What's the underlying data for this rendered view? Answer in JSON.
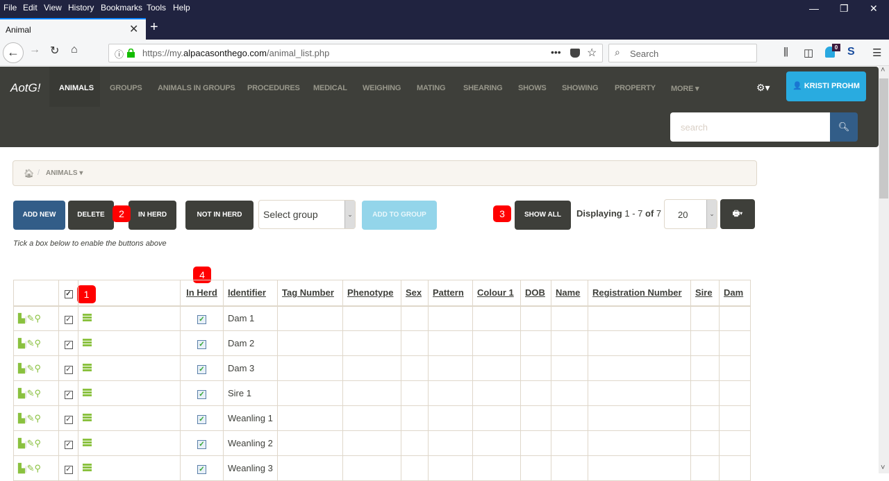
{
  "browser": {
    "menu": [
      "File",
      "Edit",
      "View",
      "History",
      "Bookmarks",
      "Tools",
      "Help"
    ],
    "tab_title": "Animal",
    "url_prefix": "https://my.",
    "url_domain": "alpacasonthego.com",
    "url_path": "/animal_list.php",
    "search_placeholder": "Search",
    "ghostery_count": "0",
    "window_controls": {
      "minimize": "—",
      "restore": "❐",
      "close": "✕"
    }
  },
  "app": {
    "brand": "AotG!",
    "nav": [
      "ANIMALS",
      "GROUPS",
      "ANIMALS IN GROUPS",
      "PROCEDURES",
      "MEDICAL",
      "WEIGHING",
      "MATING",
      "SHEARING",
      "SHOWS",
      "SHOWING",
      "PROPERTY",
      "MORE ▾"
    ],
    "active_nav": "ANIMALS",
    "user": "KRISTI PROHM",
    "search_placeholder": "search",
    "colors": {
      "navbar": "#3e3f3a",
      "primary": "#325d88",
      "info": "#29abe0",
      "badge": "#ff0000",
      "icon_green": "#8ac13f"
    }
  },
  "breadcrumb": {
    "current": "ANIMALS ▾"
  },
  "toolbar": {
    "add_new": "ADD NEW",
    "delete": "DELETE",
    "in_herd": "IN HERD",
    "not_in_herd": "NOT IN HERD",
    "select_group": "Select group",
    "add_to_group": "ADD TO GROUP",
    "show_all": "SHOW ALL",
    "displaying_label": "Displaying",
    "displaying_range": "1 - 7",
    "of_label": "of",
    "total": "7",
    "per_page": "20",
    "hint": "Tick a box below to enable the buttons above"
  },
  "badges": {
    "b1": "1",
    "b2": "2",
    "b3": "3",
    "b4": "4"
  },
  "table": {
    "columns": [
      "In Herd",
      "Identifier",
      "Tag Number",
      "Phenotype",
      "Sex",
      "Pattern",
      "Colour 1",
      "DOB",
      "Name",
      "Registration Number",
      "Sire",
      "Dam"
    ],
    "rows": [
      {
        "identifier": "Dam 1",
        "in_herd": true
      },
      {
        "identifier": "Dam 2",
        "in_herd": true
      },
      {
        "identifier": "Dam 3",
        "in_herd": true
      },
      {
        "identifier": "Sire 1",
        "in_herd": true
      },
      {
        "identifier": "Weanling 1",
        "in_herd": true
      },
      {
        "identifier": "Weanling 2",
        "in_herd": true
      },
      {
        "identifier": "Weanling 3",
        "in_herd": true
      }
    ]
  }
}
